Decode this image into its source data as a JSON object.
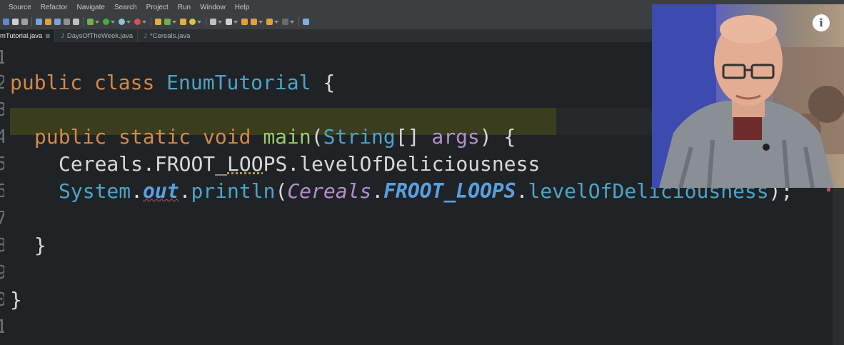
{
  "menu": [
    "Source",
    "Refactor",
    "Navigate",
    "Search",
    "Project",
    "Run",
    "Window",
    "Help"
  ],
  "tabs": [
    {
      "label": "mTutorial.java",
      "close": "⊠",
      "active": true
    },
    {
      "label": "DaysOfTheWeek.java",
      "icon": "J",
      "active": false
    },
    {
      "label": "*Cereals.java",
      "icon": "J",
      "active": false
    }
  ],
  "line_numbers": [
    "1",
    "2",
    "3",
    "4",
    "5",
    "6",
    "7",
    "8",
    "9",
    "0",
    "1"
  ],
  "code": {
    "l2": {
      "kw1": "public",
      "kw2": "class",
      "name": "EnumTutorial",
      "brace": "{"
    },
    "l4": {
      "kw1": "public",
      "kw2": "static",
      "kw3": "void",
      "method": "main",
      "paren_open": "(",
      "type": "String",
      "brackets": "[]",
      "arg": "args",
      "paren_close": ")",
      "brace": "{"
    },
    "l5": {
      "cls": "Cereals",
      "dot1": ".",
      "const_a": "FROOT_",
      "const_b": "LOO",
      "const_c": "PS",
      "dot2": ".",
      "field": "levelOfDeliciousness"
    },
    "l6": {
      "cls": "System",
      "dot1": ".",
      "out": "out",
      "dot2": ".",
      "method": "println",
      "paren_open": "(",
      "cls2": "Cereals",
      "dot3": ".",
      "const": "FROOT_LOOPS",
      "dot4": ".",
      "field": "levelOfDeliciousness",
      "tail": ");"
    },
    "l8": {
      "brace": "}"
    },
    "l10": {
      "brace": "}"
    }
  },
  "webcam": {
    "info_icon": "i",
    "description": "presenter-webcam"
  },
  "colors": {
    "editor_bg": "#1f2326",
    "keyword": "#d3884a",
    "class": "#4ea3c8",
    "method": "#9ccc65",
    "highlight": "#3a3e1f"
  }
}
